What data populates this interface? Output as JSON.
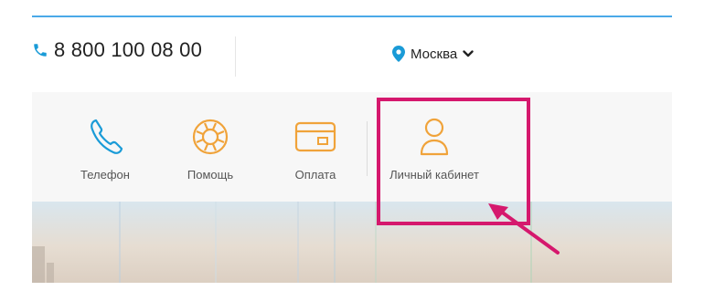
{
  "header": {
    "phone": "8 800 100 08 00",
    "city": "Москва"
  },
  "nav": {
    "items": [
      {
        "label": "Телефон",
        "icon": "phone-icon"
      },
      {
        "label": "Помощь",
        "icon": "lifebuoy-icon"
      },
      {
        "label": "Оплата",
        "icon": "card-icon"
      },
      {
        "label": "Личный кабинет",
        "icon": "user-icon"
      }
    ]
  },
  "colors": {
    "accent_blue": "#1a9bd7",
    "accent_orange": "#f0a33a",
    "highlight": "#d5186d"
  }
}
